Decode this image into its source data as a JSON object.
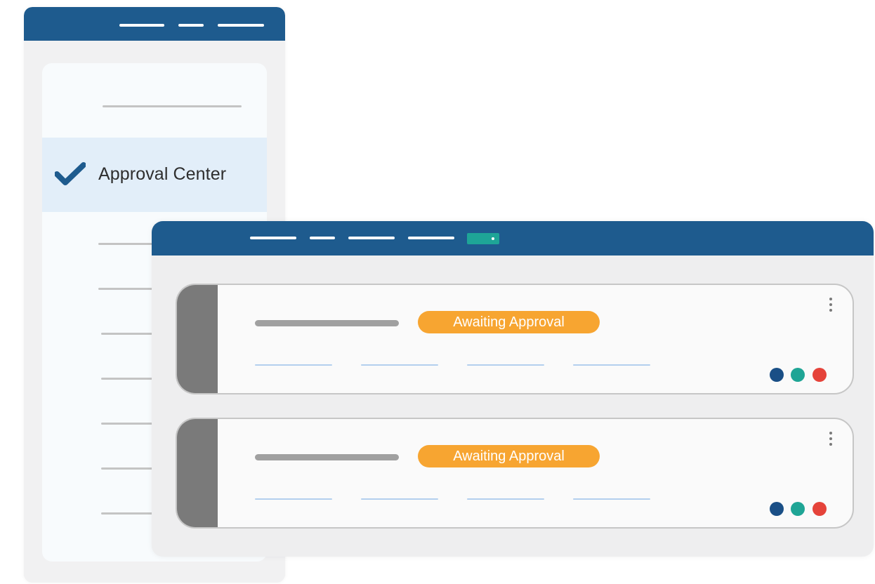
{
  "sidebar": {
    "active_item": {
      "label": "Approval Center",
      "icon": "check-icon"
    }
  },
  "records": [
    {
      "status": "Awaiting Approval"
    },
    {
      "status": "Awaiting Approval"
    }
  ],
  "colors": {
    "brand_blue": "#1e5b8e",
    "badge_orange": "#f7a531",
    "accent_teal": "#1ea597",
    "dot_navy": "#1a4f86",
    "dot_teal": "#1fa595",
    "dot_red": "#e5433a"
  }
}
